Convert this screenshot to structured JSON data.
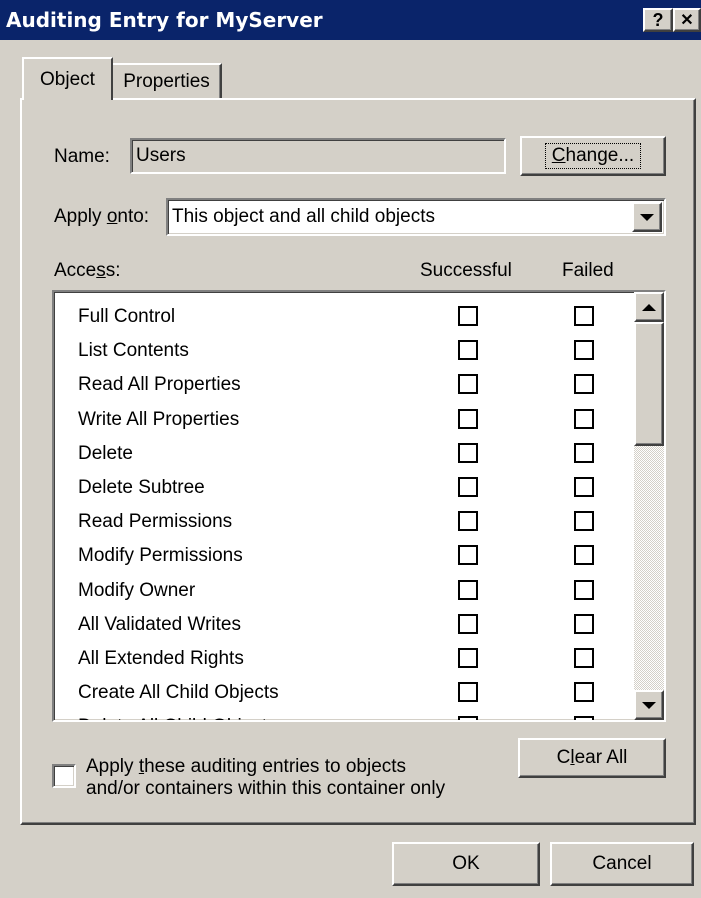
{
  "window": {
    "title": "Auditing Entry for MyServer",
    "help_glyph": "?",
    "close_glyph": "✕"
  },
  "tabs": [
    {
      "label": "Object"
    },
    {
      "label": "Properties"
    }
  ],
  "name": {
    "label": "Name:",
    "value": "Users"
  },
  "change_button": {
    "label_pre": "",
    "label_u": "C",
    "label_post": "hange..."
  },
  "apply_onto": {
    "label_pre": "Apply ",
    "label_u": "o",
    "label_post": "nto:",
    "value": "This object and all child objects"
  },
  "access": {
    "label_pre": "Acce",
    "label_u": "s",
    "label_post": "s:",
    "col_successful": "Successful",
    "col_failed": "Failed",
    "rows": [
      {
        "name": "Full Control",
        "successful": false,
        "failed": false
      },
      {
        "name": "List Contents",
        "successful": false,
        "failed": false
      },
      {
        "name": "Read All Properties",
        "successful": false,
        "failed": false
      },
      {
        "name": "Write All Properties",
        "successful": false,
        "failed": false
      },
      {
        "name": "Delete",
        "successful": false,
        "failed": false
      },
      {
        "name": "Delete Subtree",
        "successful": false,
        "failed": false
      },
      {
        "name": "Read Permissions",
        "successful": false,
        "failed": false
      },
      {
        "name": "Modify Permissions",
        "successful": false,
        "failed": false
      },
      {
        "name": "Modify Owner",
        "successful": false,
        "failed": false
      },
      {
        "name": "All Validated Writes",
        "successful": false,
        "failed": false
      },
      {
        "name": "All Extended Rights",
        "successful": false,
        "failed": false
      },
      {
        "name": "Create All Child Objects",
        "successful": false,
        "failed": false
      },
      {
        "name": "Delete All Child Objects",
        "successful": false,
        "failed": false
      }
    ]
  },
  "apply_only": {
    "checked": false,
    "line1_pre": "Apply ",
    "line1_u": "t",
    "line1_post": "hese auditing entries to objects",
    "line2": "and/or containers within this container only"
  },
  "clear_all_button": {
    "label_pre": "C",
    "label_u": "l",
    "label_post": "ear All"
  },
  "ok_button": {
    "label": "OK"
  },
  "cancel_button": {
    "label": "Cancel"
  },
  "colors": {
    "titlebar": "#0a246a",
    "face": "#d4d0c8"
  }
}
